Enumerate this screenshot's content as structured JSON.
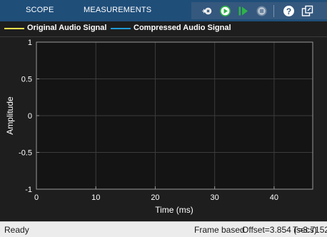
{
  "toolstrip": {
    "tabs": [
      {
        "label": "SCOPE"
      },
      {
        "label": "MEASUREMENTS"
      }
    ],
    "quick_access": [
      {
        "name": "settings-icon"
      },
      {
        "name": "run-icon"
      },
      {
        "name": "step-forward-icon"
      },
      {
        "name": "stop-icon"
      },
      {
        "name": "help-icon"
      },
      {
        "name": "undock-icon"
      }
    ]
  },
  "legend": {
    "items": [
      {
        "label": "Original Audio Signal",
        "color": "#ffe14d"
      },
      {
        "label": "Compressed Audio Signal",
        "color": "#1f9bd9"
      }
    ]
  },
  "chart_data": {
    "type": "line",
    "xlabel": "Time (ms)",
    "ylabel": "Amplitude",
    "xlim": [
      0,
      46.5
    ],
    "ylim": [
      -1,
      1
    ],
    "xticks": [
      "0",
      "10",
      "20",
      "30",
      "40"
    ],
    "yticks": [
      "1",
      "0.5",
      "0",
      "-0.5",
      "-1"
    ],
    "grid": true,
    "background": "#141414",
    "series": [
      {
        "name": "Original Audio Signal",
        "color": "#ffe14d",
        "values": []
      },
      {
        "name": "Compressed Audio Signal",
        "color": "#1f9bd9",
        "values": []
      }
    ]
  },
  "status": {
    "left": "Ready",
    "mode": "Frame based",
    "offset": "Offset=3.854 (secs)",
    "time": "T=3.7152"
  }
}
